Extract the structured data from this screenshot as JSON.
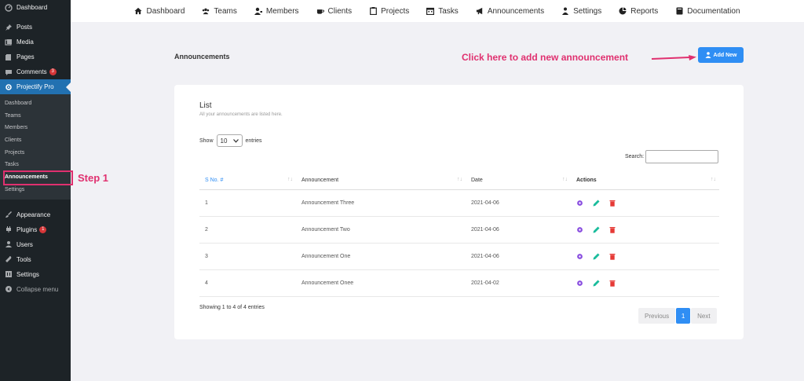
{
  "sidebar": {
    "top_items": [
      {
        "label": "Dashboard",
        "icon": "dashboard-icon"
      },
      {
        "label": "Posts",
        "icon": "pin-icon"
      },
      {
        "label": "Media",
        "icon": "media-icon"
      },
      {
        "label": "Pages",
        "icon": "pages-icon"
      },
      {
        "label": "Comments",
        "icon": "comment-icon",
        "badge": "3"
      },
      {
        "label": "Projectify Pro",
        "icon": "gear-icon"
      }
    ],
    "sub_items": [
      "Dashboard",
      "Teams",
      "Members",
      "Clients",
      "Projects",
      "Tasks",
      "Announcements",
      "Settings"
    ],
    "bottom_items": [
      {
        "label": "Appearance",
        "icon": "brush-icon"
      },
      {
        "label": "Plugins",
        "icon": "plug-icon",
        "badge": "1"
      },
      {
        "label": "Users",
        "icon": "user-icon"
      },
      {
        "label": "Tools",
        "icon": "wrench-icon"
      },
      {
        "label": "Settings",
        "icon": "settings-icon"
      },
      {
        "label": "Collapse menu",
        "icon": "collapse-icon"
      }
    ],
    "step_label": "Step 1"
  },
  "topnav": [
    "Dashboard",
    "Teams",
    "Members",
    "Clients",
    "Projects",
    "Tasks",
    "Announcements",
    "Settings",
    "Reports",
    "Documentation"
  ],
  "header": {
    "title": "Announcements",
    "hint": "Click here to add new announcement",
    "add_button": "Add New"
  },
  "list": {
    "title": "List",
    "subtitle": "All your announcements are listed here.",
    "show_label": "Show",
    "entries_value": "10",
    "entries_label": "entries",
    "search_label": "Search:",
    "columns": [
      "S No. #",
      "Announcement",
      "Date",
      "Actions"
    ],
    "rows": [
      {
        "no": "1",
        "name": "Announcement Three",
        "date": "2021-04-06"
      },
      {
        "no": "2",
        "name": "Announcement Two",
        "date": "2021-04-06"
      },
      {
        "no": "3",
        "name": "Announcement One",
        "date": "2021-04-06"
      },
      {
        "no": "4",
        "name": "Announcement Onee",
        "date": "2021-04-02"
      }
    ],
    "info": "Showing 1 to 4 of 4 entries",
    "pager": {
      "previous": "Previous",
      "current": "1",
      "next": "Next"
    }
  },
  "colors": {
    "sidebar_bg": "#1d2327",
    "active": "#2271b1",
    "accent": "#2f8ef4",
    "annotation": "#e0306f",
    "view_icon": "#8a4fe0",
    "edit_icon": "#1abc9c",
    "delete_icon": "#e53935"
  }
}
